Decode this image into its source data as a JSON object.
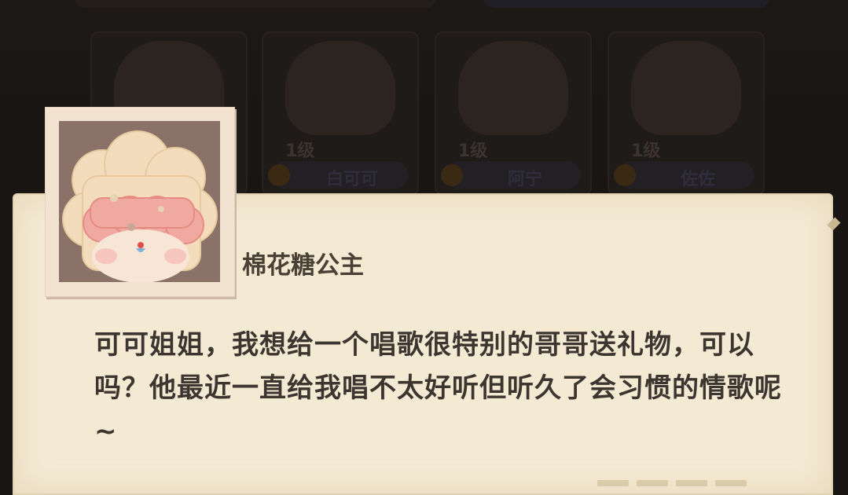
{
  "background_slots": [
    {
      "level": "",
      "name": ""
    },
    {
      "level": "1级",
      "name": "白可可"
    },
    {
      "level": "1级",
      "name": "阿宁"
    },
    {
      "level": "1级",
      "name": "佐佐"
    }
  ],
  "dialog": {
    "speaker": "棉花糖公主",
    "text": "可可姐姐，我想给一个唱歌很特别的哥哥送礼物，可以吗？他最近一直给我唱不太好听但听久了会习惯的情歌呢~"
  },
  "avatar": {
    "icon": "marshmallow-princess-portrait"
  },
  "colors": {
    "paper": "#f4ead3",
    "text": "#3c3530",
    "overlay": "#1a1614"
  }
}
